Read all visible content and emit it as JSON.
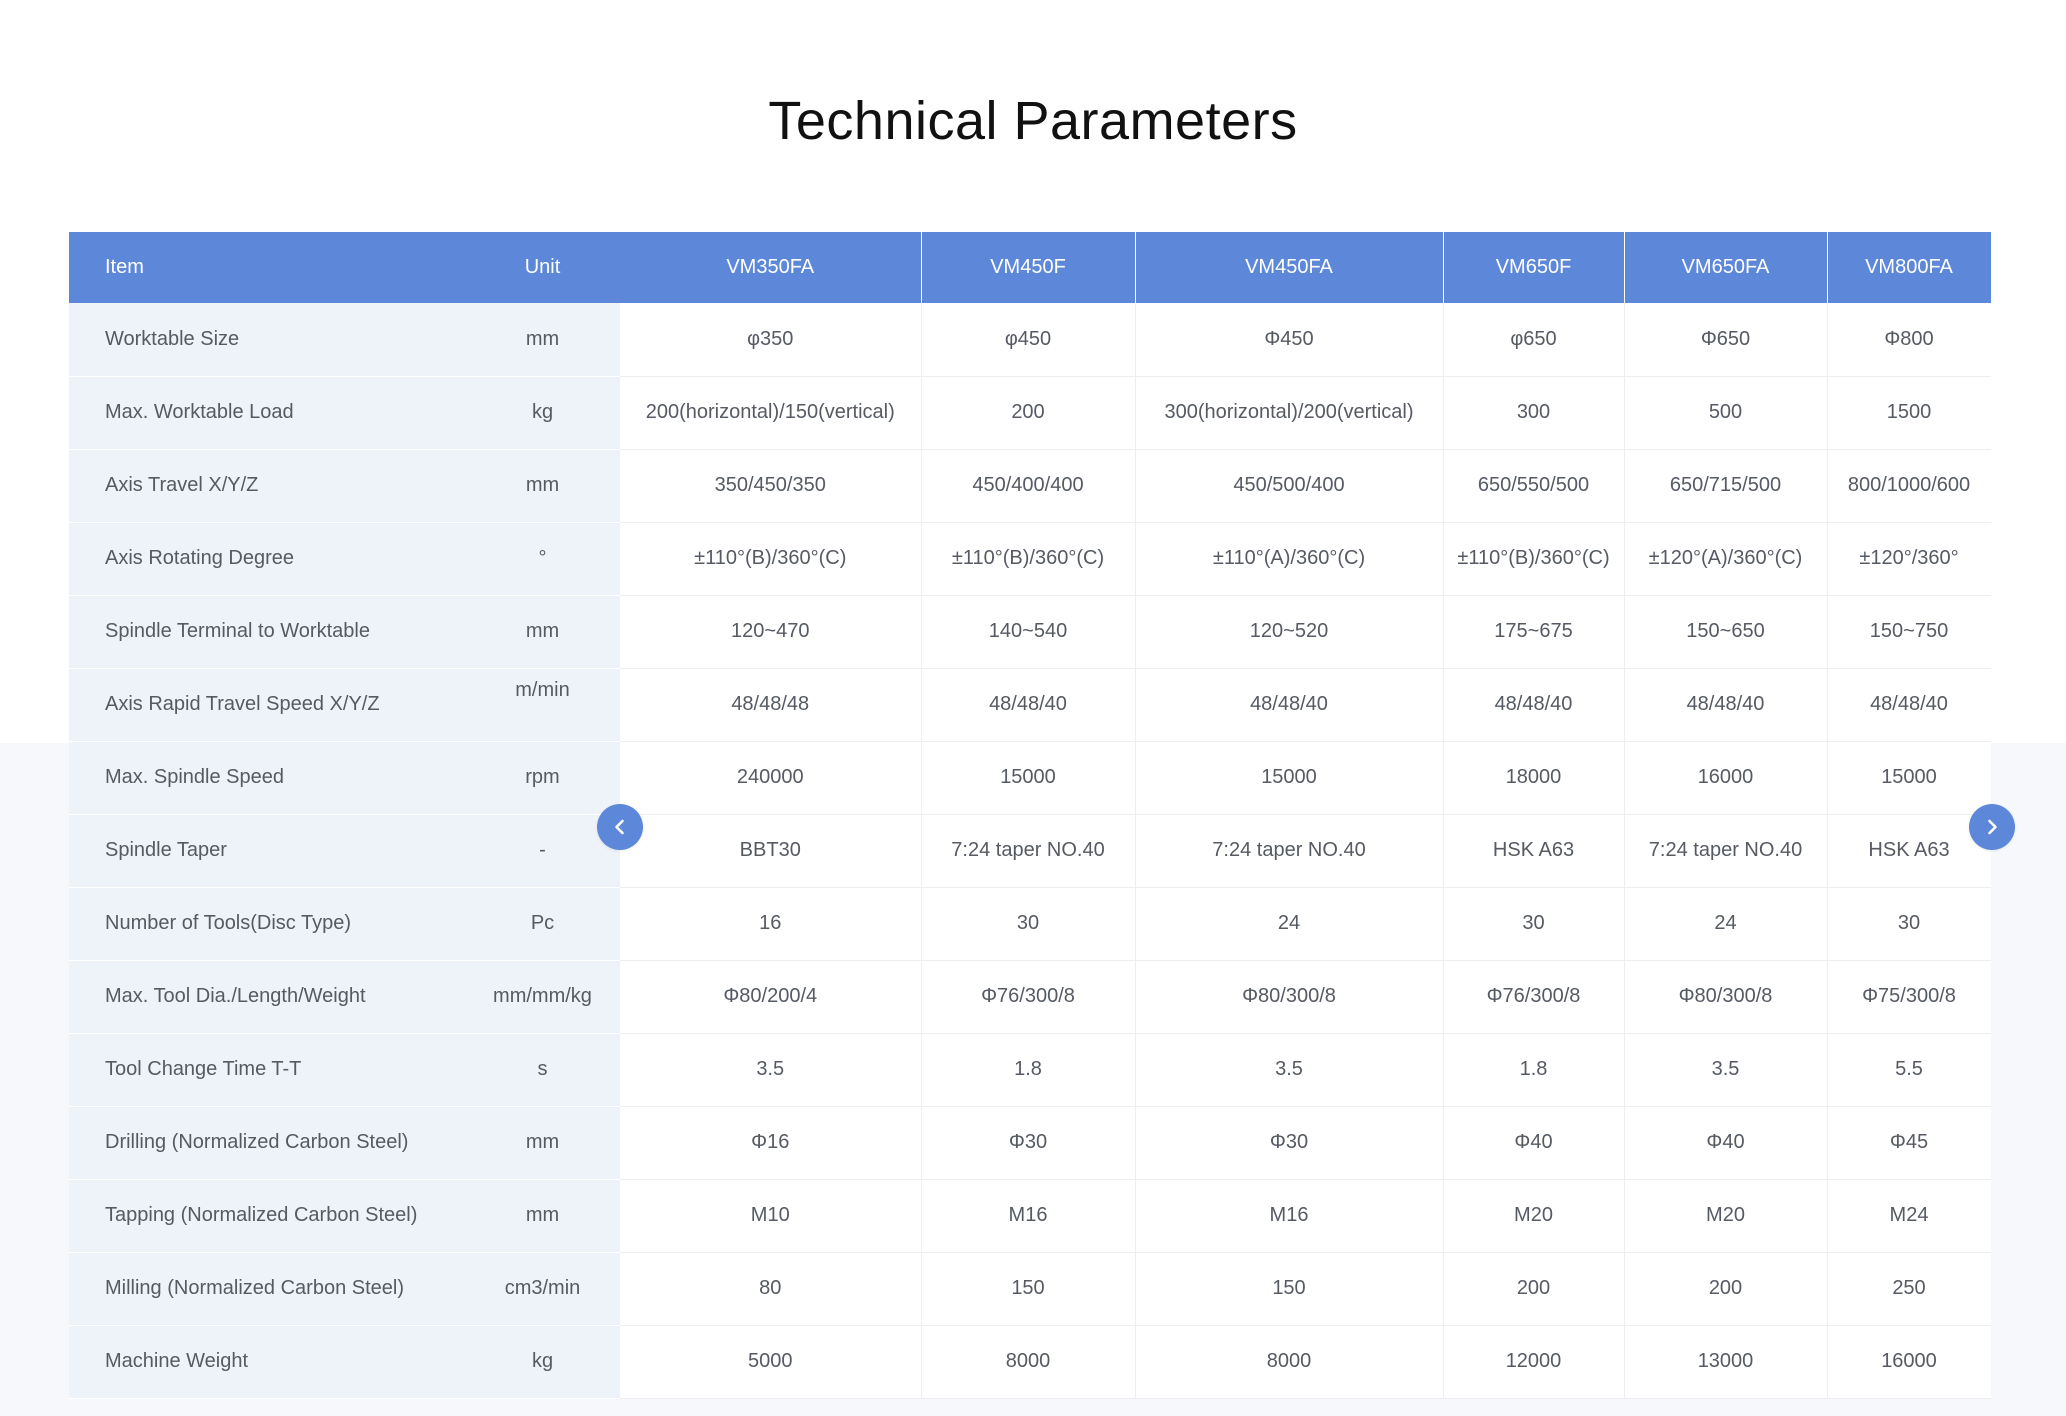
{
  "page_title": "Technical Parameters",
  "colors": {
    "header_bg": "#5d87d9",
    "label_col_bg": "#eef2f9",
    "nav_button": "#5d87d9",
    "text": "#555a63"
  },
  "table": {
    "headers": [
      "Item",
      "Unit",
      "VM350FA",
      "VM450F",
      "VM450FA",
      "VM650F",
      "VM650FA",
      "VM800FA"
    ],
    "rows": [
      [
        "Worktable   Size",
        "mm",
        "φ350",
        "φ450",
        "Φ450",
        "φ650",
        "Φ650",
        "Φ800"
      ],
      [
        "Max. Worktable Load",
        "kg",
        "200(horizontal)/150(vertical)",
        "200",
        "300(horizontal)/200(vertical)",
        "300",
        "500",
        "1500"
      ],
      [
        "Axis Travel X/Y/Z",
        "mm",
        "350/450/350",
        "450/400/400",
        "450/500/400",
        "650/550/500",
        "650/715/500",
        "800/1000/600"
      ],
      [
        "Axis Rotating Degree",
        "°",
        "±110°(B)/360°(C)",
        "±110°(B)/360°(C)",
        "±110°(A)/360°(C)",
        "±110°(B)/360°(C)",
        "±120°(A)/360°(C)",
        "±120°/360°"
      ],
      [
        "Spindle Terminal to Worktable",
        "mm",
        "120~470",
        "140~540",
        "120~520",
        "175~675",
        "150~650",
        "150~750"
      ],
      [
        "Axis Rapid Travel  Speed   X/Y/Z",
        "m/min",
        "48/48/48",
        "48/48/40",
        "48/48/40",
        "48/48/40",
        "48/48/40",
        "48/48/40"
      ],
      [
        "Max. Spindle Speed",
        "rpm",
        "240000",
        "15000",
        "15000",
        "18000",
        "16000",
        "15000"
      ],
      [
        "Spindle Taper",
        "-",
        "BBT30",
        "7:24     taper NO.40",
        "7:24     taper NO.40",
        "HSK   A63",
        "7:24   taper NO.40",
        "HSK A63"
      ],
      [
        "Number of Tools(Disc Type)",
        "Pc",
        "16",
        "30",
        "24",
        "30",
        "24",
        "30"
      ],
      [
        "Max. Tool Dia./Length/Weight",
        "mm/mm/kg",
        "Φ80/200/4",
        "Φ76/300/8",
        "Φ80/300/8",
        "Φ76/300/8",
        "Φ80/300/8",
        "Φ75/300/8"
      ],
      [
        "Tool Change Time T-T",
        "s",
        "3.5",
        "1.8",
        "3.5",
        "1.8",
        "3.5",
        "5.5"
      ],
      [
        "Drilling (Normalized Carbon Steel)",
        "mm",
        "Φ16",
        "Φ30",
        "Φ30",
        "Φ40",
        "Φ40",
        "Φ45"
      ],
      [
        "Tapping (Normalized Carbon Steel)",
        "mm",
        "M10",
        "M16",
        "M16",
        "M20",
        "M20",
        "M24"
      ],
      [
        "Milling (Normalized Carbon Steel)",
        "cm3/min",
        "80",
        "150",
        "150",
        "200",
        "200",
        "250"
      ],
      [
        "Machine Weight",
        "kg",
        "5000",
        "8000",
        "8000",
        "12000",
        "13000",
        "16000"
      ]
    ]
  },
  "nav": {
    "prev_icon": "chevron-left-icon",
    "next_icon": "chevron-right-icon"
  }
}
